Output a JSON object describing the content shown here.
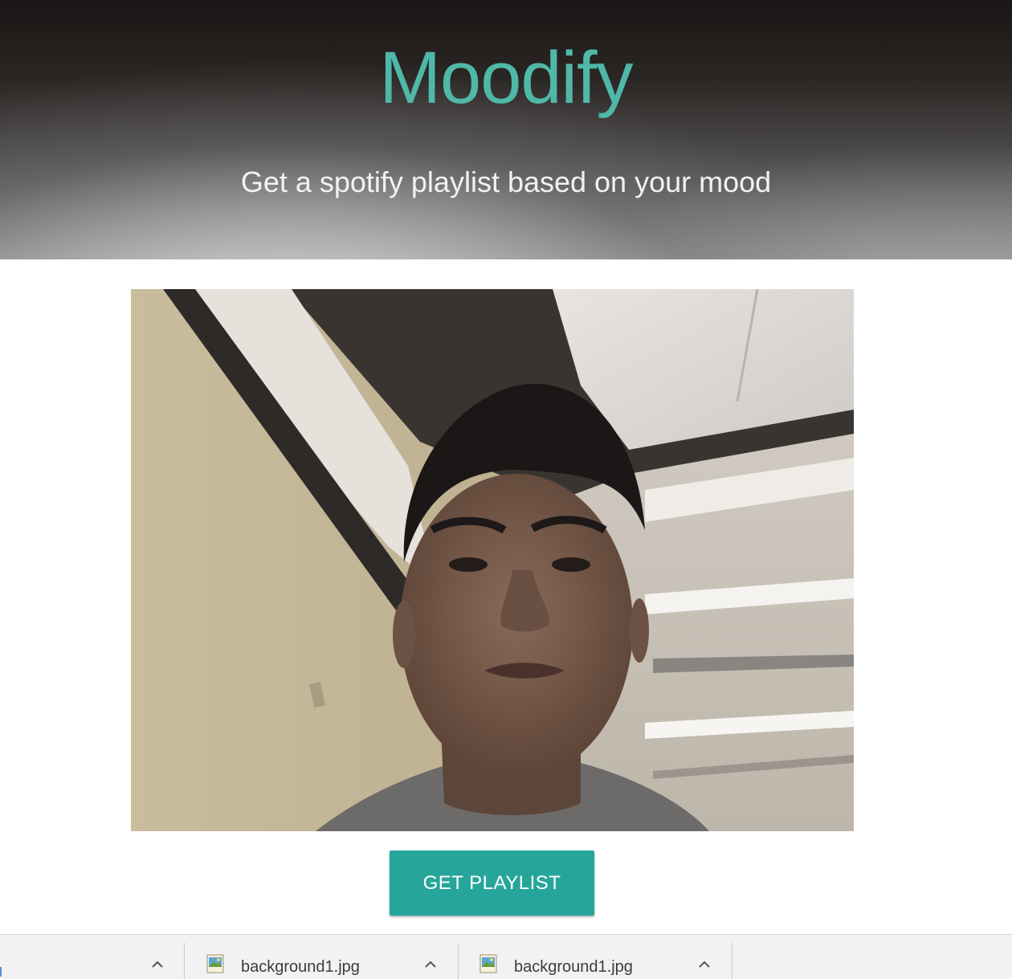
{
  "hero": {
    "title": "Moodify",
    "subtitle": "Get a spotify playlist based on your mood",
    "title_color": "#4fb8a8"
  },
  "camera": {
    "label": "webcam-feed"
  },
  "actions": {
    "get_playlist_label": "GET PLAYLIST",
    "button_color": "#26a69a"
  },
  "downloads_bar": {
    "items": [
      {
        "filename": "background1.jpg",
        "icon": "image-file-icon"
      },
      {
        "filename": "background1.jpg",
        "icon": "image-file-icon"
      }
    ],
    "chevron_icon": "chevron-up-icon"
  }
}
